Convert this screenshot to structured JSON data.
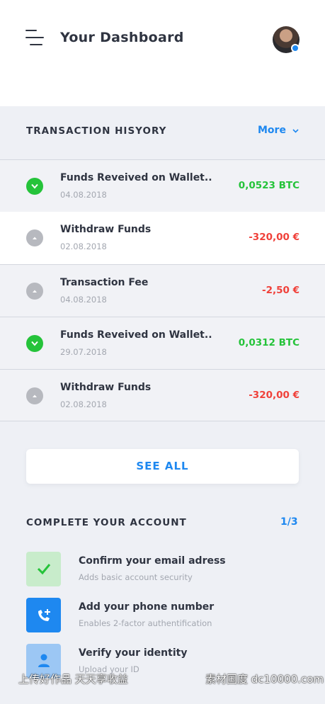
{
  "header": {
    "title": "Your Dashboard"
  },
  "transactions": {
    "section_title": "TRANSACTION HISYORY",
    "more_label": "More",
    "items": [
      {
        "title": "Funds Reveived on Wallet..",
        "date": "04.08.2018",
        "amount": "0,0523 BTC",
        "type": "incoming"
      },
      {
        "title": "Withdraw Funds",
        "date": "02.08.2018",
        "amount": "-320,00 €",
        "type": "outgoing"
      },
      {
        "title": "Transaction Fee",
        "date": "04.08.2018",
        "amount": "-2,50 €",
        "type": "outgoing"
      },
      {
        "title": "Funds Reveived on Wallet..",
        "date": "29.07.2018",
        "amount": "0,0312 BTC",
        "type": "incoming"
      },
      {
        "title": "Withdraw Funds",
        "date": "02.08.2018",
        "amount": "-320,00 €",
        "type": "outgoing"
      }
    ],
    "see_all_label": "SEE ALL"
  },
  "account": {
    "section_title": "COMPLETE YOUR ACCOUNT",
    "progress": "1/3",
    "steps": [
      {
        "title": "Confirm your email adress",
        "subtitle": "Adds basic account security",
        "icon": "check-icon",
        "done": true
      },
      {
        "title": "Add your phone number",
        "subtitle": "Enables 2-factor authentification",
        "icon": "phone-plus-icon",
        "done": false
      },
      {
        "title": "Verify your identity",
        "subtitle": "Upload your ID",
        "icon": "user-icon",
        "done": false
      }
    ]
  },
  "watermark": {
    "left": "上传好作品 天天享收益",
    "right": "素材国度 dc10000.com"
  },
  "colors": {
    "accent": "#1e88f0",
    "positive": "#25c33a",
    "negative": "#f0413a",
    "muted": "#b7b9bf"
  }
}
